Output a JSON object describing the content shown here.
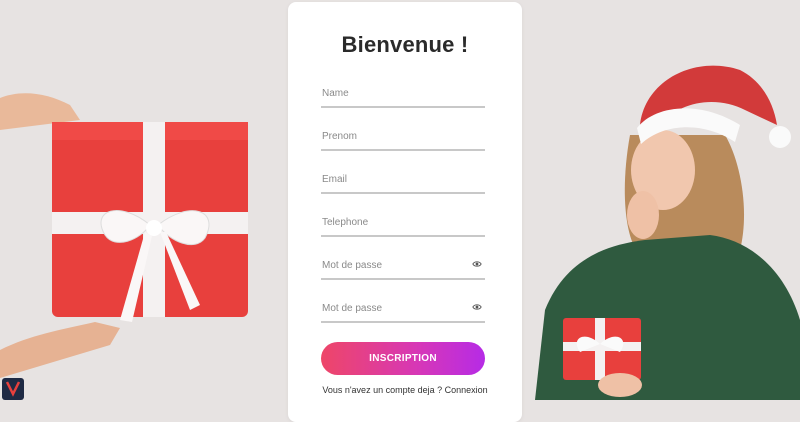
{
  "form": {
    "title": "Bienvenue !",
    "fields": [
      {
        "placeholder": "Name",
        "value": ""
      },
      {
        "placeholder": "Prenom",
        "value": ""
      },
      {
        "placeholder": "Email",
        "value": ""
      },
      {
        "placeholder": "Telephone",
        "value": ""
      },
      {
        "placeholder": "Mot de passe",
        "value": ""
      },
      {
        "placeholder": "Mot de passe",
        "value": ""
      }
    ],
    "submit_label": "INSCRIPTION",
    "footer_text": "Vous n'avez un compte deja ?",
    "login_link": "Connexion",
    "password_toggle_icon": "eye-icon"
  },
  "colors": {
    "background": "#e7e3e2",
    "button_gradient_start": "#ee4668",
    "button_gradient_end": "#b62be6",
    "gift_red": "#e8403d",
    "ribbon": "#f4f1f1",
    "sweater_green": "#2f5a3f",
    "hat_red": "#d23a3a"
  }
}
